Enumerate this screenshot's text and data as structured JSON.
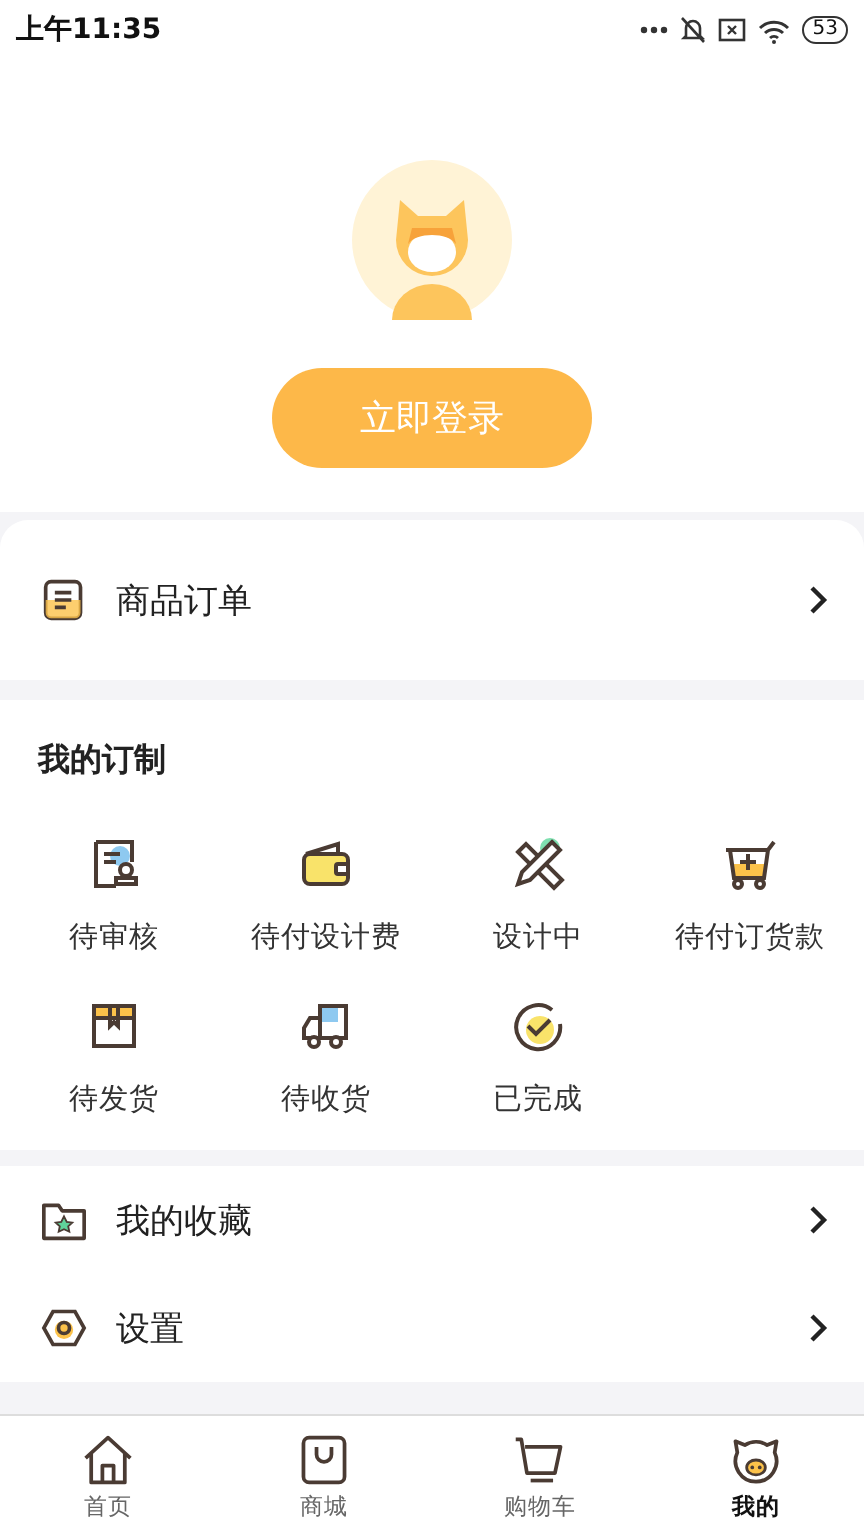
{
  "status_bar": {
    "time": "上午11:35",
    "battery": "53"
  },
  "profile": {
    "login_button": "立即登录"
  },
  "orders_row": {
    "label": "商品订单"
  },
  "custom_section": {
    "title": "我的订制",
    "items": [
      {
        "kind": "review",
        "label": "待审核"
      },
      {
        "kind": "wallet",
        "label": "待付设计费"
      },
      {
        "kind": "design",
        "label": "设计中"
      },
      {
        "kind": "cart",
        "label": "待付订货款"
      },
      {
        "kind": "box",
        "label": "待发货"
      },
      {
        "kind": "truck",
        "label": "待收货"
      },
      {
        "kind": "done",
        "label": "已完成"
      }
    ]
  },
  "menu": [
    {
      "kind": "favorites",
      "label": "我的收藏"
    },
    {
      "kind": "settings",
      "label": "设置"
    }
  ],
  "tab_bar": [
    {
      "kind": "home",
      "label": "首页",
      "selected": false
    },
    {
      "kind": "shop",
      "label": "商城",
      "selected": false
    },
    {
      "kind": "cart",
      "label": "购物车",
      "selected": false
    },
    {
      "kind": "me",
      "label": "我的",
      "selected": true
    }
  ]
}
